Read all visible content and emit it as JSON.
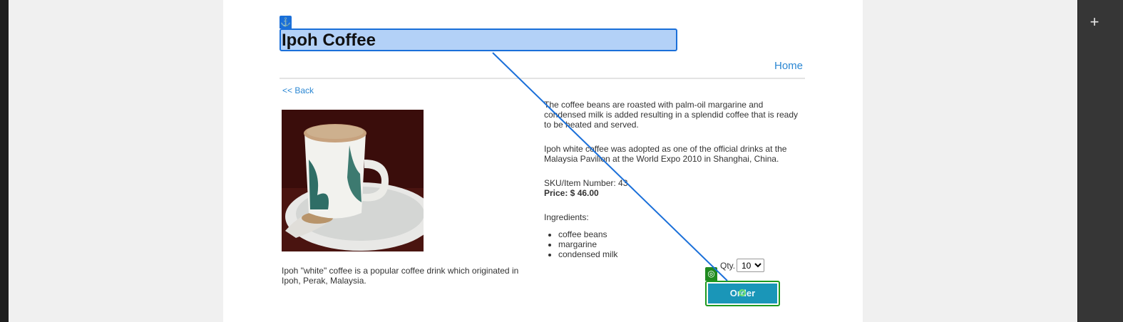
{
  "header": {
    "title": "Ipoh Coffee"
  },
  "nav": {
    "home": "Home",
    "back": "<< Back"
  },
  "product": {
    "description_short": "Ipoh \"white\" coffee is a popular coffee drink which originated in Ipoh, Perak, Malaysia.",
    "description_p1": "The coffee beans are roasted with palm-oil margarine and condensed milk is added resulting in a splendid coffee that is ready to be heated and served.",
    "description_p2": "Ipoh white coffee was adopted as one of the official drinks at the Malaysia Pavilion at the World Expo 2010 in Shanghai, China.",
    "sku_label": "SKU/Item Number: 43",
    "price_label": "Price: $ 46.00",
    "ingredients_label": "Ingredients:",
    "ingredients": [
      "coffee beans",
      "margarine",
      "condensed milk"
    ]
  },
  "order": {
    "qty_label": "Qty.",
    "qty_value": "10",
    "button_label": "Order"
  },
  "icons": {
    "anchor": "anchor-icon",
    "target": "target-icon",
    "add": "plus-icon"
  },
  "colors": {
    "link": "#2b87d3",
    "selection": "#1a6fd9",
    "order_button": "#1a96b8",
    "target_outline": "#1f9a1f"
  }
}
